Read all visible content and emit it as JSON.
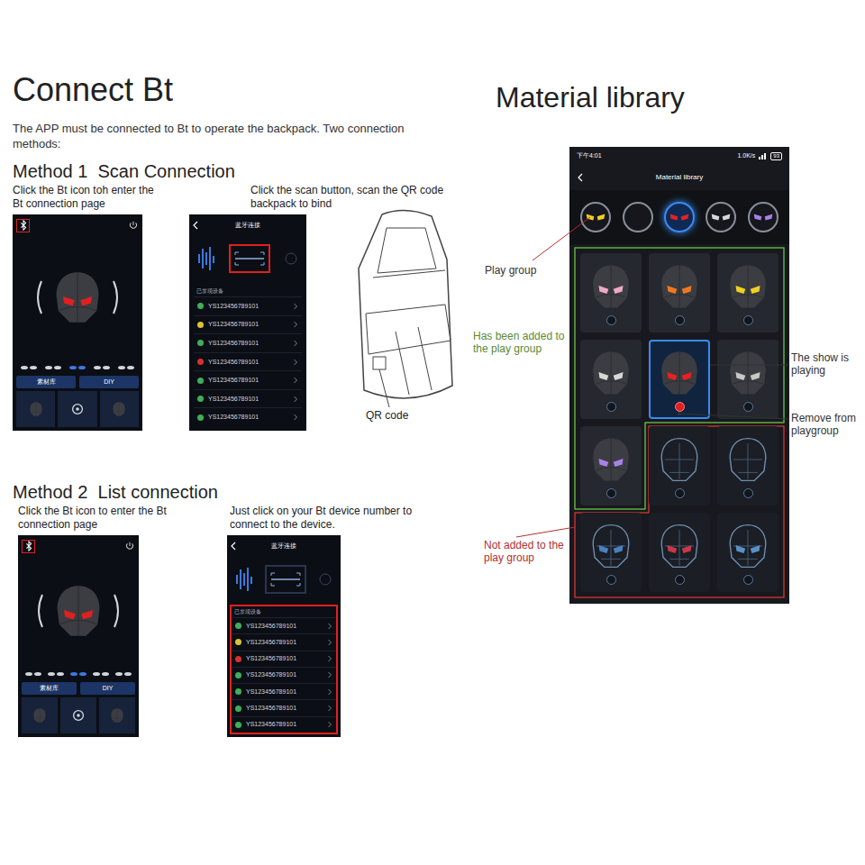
{
  "connect_bt": {
    "title": "Connect Bt",
    "intro": "The APP must be connected to Bt to operate the backpack. Two connection methods:",
    "methods": [
      {
        "title": "Method 1  Scan Connection",
        "steps": [
          "Click the Bt icon toh enter the Bt connection page",
          "Click the scan button, scan the QR code backpack to bind"
        ],
        "home_screen": {
          "bt_highlighted": true,
          "buttons": [
            "素材库",
            "DIY"
          ]
        },
        "connect_screen": {
          "title": "蓝牙连接",
          "section": "已发现设备",
          "scan_highlighted": true,
          "list_highlighted": false,
          "devices": [
            {
              "id": "YS123456789101",
              "color": "#3fae5a"
            },
            {
              "id": "YS123456789101",
              "color": "#e0c030"
            },
            {
              "id": "YS123456789101",
              "color": "#3fae5a"
            },
            {
              "id": "YS123456789101",
              "color": "#d83030"
            },
            {
              "id": "YS123456789101",
              "color": "#3fae5a"
            },
            {
              "id": "YS123456789101",
              "color": "#3fae5a"
            },
            {
              "id": "YS123456789101",
              "color": "#3fae5a"
            }
          ]
        },
        "qr_label": "QR code"
      },
      {
        "title": "Method 2  List connection",
        "steps": [
          "Click the Bt icon to enter the Bt connection page",
          "Just click on your Bt device number to connect to the device."
        ],
        "home_screen": {
          "bt_highlighted": true,
          "buttons": [
            "素材库",
            "DIY"
          ]
        },
        "connect_screen": {
          "title": "蓝牙连接",
          "section": "已发现设备",
          "scan_highlighted": false,
          "list_highlighted": true,
          "devices": [
            {
              "id": "YS123456789101",
              "color": "#3fae5a"
            },
            {
              "id": "YS123456789101",
              "color": "#e0c030"
            },
            {
              "id": "YS123456789101",
              "color": "#d83030"
            },
            {
              "id": "YS123456789101",
              "color": "#3fae5a"
            },
            {
              "id": "YS123456789101",
              "color": "#3fae5a"
            },
            {
              "id": "YS123456789101",
              "color": "#3fae5a"
            },
            {
              "id": "YS123456789101",
              "color": "#3fae5a"
            }
          ]
        }
      }
    ]
  },
  "material_library": {
    "heading": "Material library",
    "phone": {
      "status": {
        "time": "下午4:01",
        "speed": "1.0K/s",
        "battery": "93"
      },
      "title": "Material library",
      "play_group": [
        {
          "color": "#f0d020",
          "selected": false
        },
        {
          "selected": false
        },
        {
          "color": "#e82020",
          "selected": true
        },
        {
          "color": "#d8d8d8",
          "selected": false
        },
        {
          "color": "#a880e8",
          "selected": false
        }
      ],
      "tiles": [
        {
          "added": true,
          "playing": false,
          "color": "#f0a8c8"
        },
        {
          "added": true,
          "playing": false,
          "color": "#f07820"
        },
        {
          "added": true,
          "playing": false,
          "color": "#f0d020"
        },
        {
          "added": true,
          "playing": false,
          "color": "#d8d8d8"
        },
        {
          "added": true,
          "playing": true,
          "color": "#e82020"
        },
        {
          "added": true,
          "playing": false,
          "color": "#c8c8c8"
        },
        {
          "added": true,
          "playing": false,
          "color": "#a880e8"
        },
        {
          "added": false,
          "playing": false
        },
        {
          "added": false,
          "playing": false
        },
        {
          "added": false,
          "playing": false,
          "color": "#4a80c0"
        },
        {
          "added": false,
          "playing": false,
          "color": "#c83848"
        },
        {
          "added": false,
          "playing": false,
          "color": "#5a90c8"
        }
      ]
    },
    "annotations": [
      {
        "text": "Play group",
        "color": "#333333"
      },
      {
        "text": "Has been added to the play group",
        "color": "#5a8a32"
      },
      {
        "text": "The show is playing",
        "color": "#333333"
      },
      {
        "text": "Remove from playgroup",
        "color": "#333333"
      },
      {
        "text": "Not added to the play group",
        "color": "#b03030"
      }
    ]
  }
}
